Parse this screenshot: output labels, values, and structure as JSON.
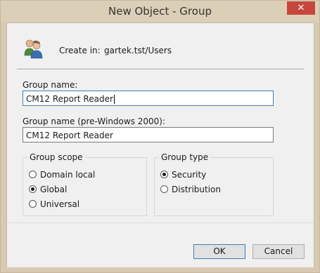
{
  "window": {
    "title": "New Object - Group",
    "close_glyph": "✕"
  },
  "header": {
    "icon": "users-icon",
    "create_in_label": "Create in:",
    "create_in_value": "gartek.tst/Users"
  },
  "form": {
    "group_name_label": "Group name:",
    "group_name_value": "CM12 Report Reader",
    "group_name_pre2000_label": "Group name (pre-Windows 2000):",
    "group_name_pre2000_value": "CM12 Report Reader"
  },
  "group_scope": {
    "title": "Group scope",
    "options": [
      "Domain local",
      "Global",
      "Universal"
    ],
    "selected": "Global"
  },
  "group_type": {
    "title": "Group type",
    "options": [
      "Security",
      "Distribution"
    ],
    "selected": "Security"
  },
  "buttons": {
    "ok": "OK",
    "cancel": "Cancel"
  },
  "colors": {
    "accent": "#3c7fb1",
    "titlebar": "#dccfb7",
    "close": "#c7463c",
    "client": "#f0f0f0"
  }
}
